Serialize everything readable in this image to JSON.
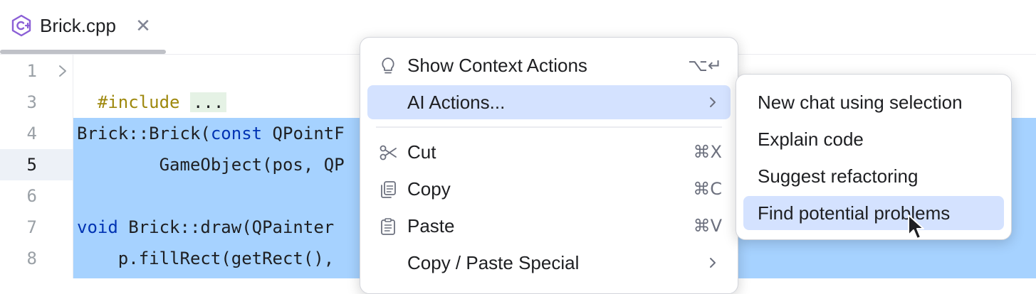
{
  "tab": {
    "title": "Brick.cpp",
    "icon": "cpp-file-icon",
    "close_glyph": "✕"
  },
  "gutter": {
    "line_numbers": [
      "1",
      "3",
      "4",
      "5",
      "6",
      "7",
      "8"
    ],
    "current_line": "5"
  },
  "code": {
    "line1_directive": "#include",
    "line1_folded": "...",
    "line4_a": "Brick::Brick(",
    "line4_kw": "const",
    "line4_b": " QPointF",
    "line5": "        GameObject(pos, QP",
    "line7_kw": "void",
    "line7_b": " Brick::draw(QPainter ",
    "line8": "    p.fillRect(getRect(), "
  },
  "context_menu": {
    "items": [
      {
        "label": "Show Context Actions",
        "shortcut": "⌥↵",
        "icon": "lightbulb-icon"
      },
      {
        "label": "AI Actions...",
        "submenu": true,
        "highlighted": true
      },
      {
        "label": "Cut",
        "shortcut": "⌘X",
        "icon": "scissors-icon"
      },
      {
        "label": "Copy",
        "shortcut": "⌘C",
        "icon": "copy-icon"
      },
      {
        "label": "Paste",
        "shortcut": "⌘V",
        "icon": "clipboard-icon"
      },
      {
        "label": "Copy / Paste Special",
        "submenu": true
      }
    ]
  },
  "ai_submenu": {
    "items": [
      {
        "label": "New chat using selection"
      },
      {
        "label": "Explain code"
      },
      {
        "label": "Suggest refactoring"
      },
      {
        "label": "Find potential problems",
        "highlighted": true
      }
    ]
  },
  "colors": {
    "selection": "#a6d2ff",
    "menu_highlight": "#d4e2ff",
    "keyword": "#0033b3",
    "directive": "#9e880d"
  }
}
